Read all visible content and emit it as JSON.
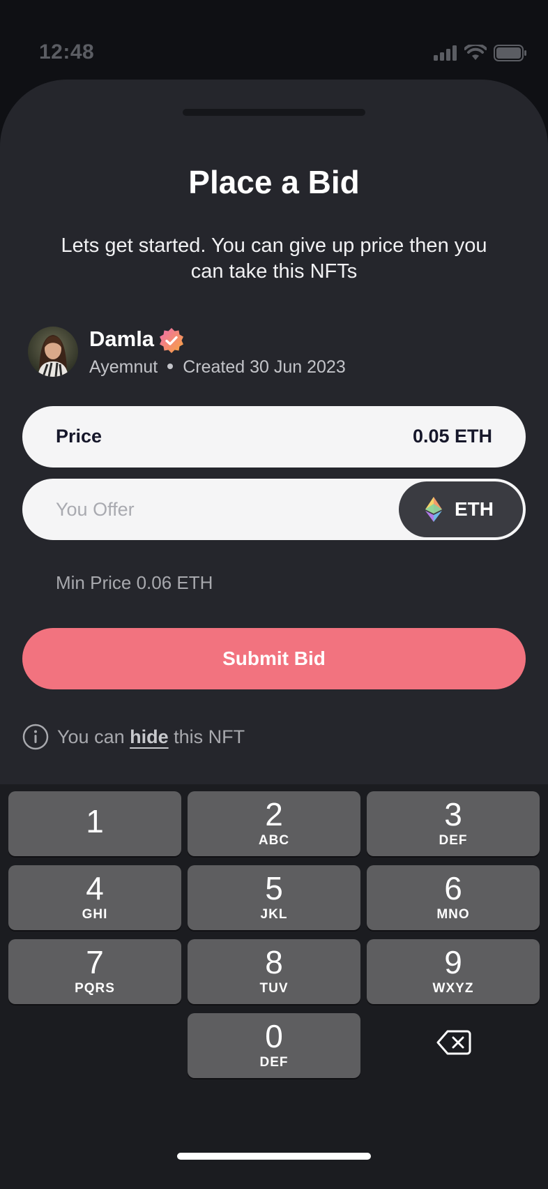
{
  "status_bar": {
    "time": "12:48"
  },
  "sheet": {
    "title": "Place a Bid",
    "subtitle": "Lets get started. You can give up price then you can take this NFTs"
  },
  "creator": {
    "name": "Damla",
    "handle": "Ayemnut",
    "created": "Created 30 Jun 2023"
  },
  "price": {
    "label": "Price",
    "value": "0.05 ETH"
  },
  "offer": {
    "placeholder": "You Offer",
    "value": "",
    "currency": "ETH"
  },
  "min_price": "Min Price 0.06 ETH",
  "submit_label": "Submit Bid",
  "hint": {
    "prefix": "You can",
    "link": "hide",
    "suffix": "this NFT"
  },
  "keypad": [
    {
      "digit": "1",
      "letters": ""
    },
    {
      "digit": "2",
      "letters": "ABC"
    },
    {
      "digit": "3",
      "letters": "DEF"
    },
    {
      "digit": "4",
      "letters": "GHI"
    },
    {
      "digit": "5",
      "letters": "JKL"
    },
    {
      "digit": "6",
      "letters": "MNO"
    },
    {
      "digit": "7",
      "letters": "PQRS"
    },
    {
      "digit": "8",
      "letters": "TUV"
    },
    {
      "digit": "9",
      "letters": "WXYZ"
    },
    {
      "digit": "0",
      "letters": "DEF"
    }
  ],
  "colors": {
    "accent": "#f2737f",
    "sheet_bg": "#25262c",
    "background": "#0f1014",
    "key_bg": "#5e5e60"
  }
}
